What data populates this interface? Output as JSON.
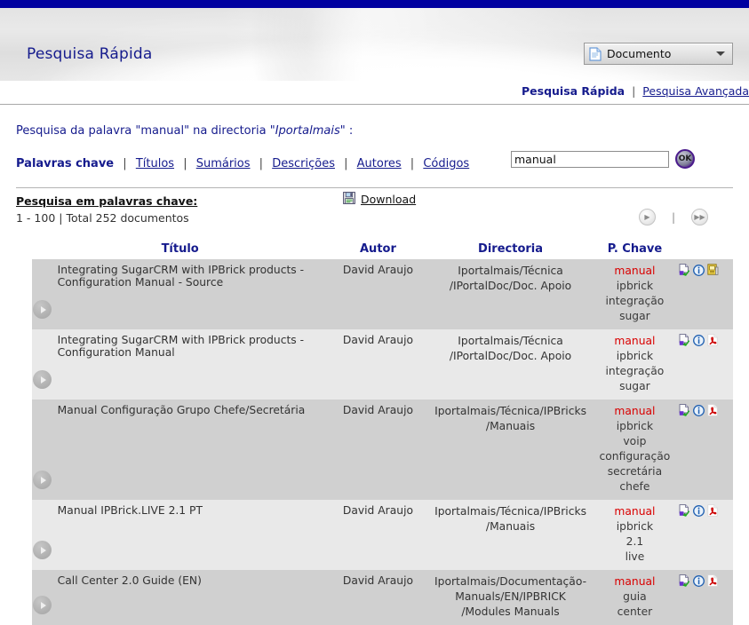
{
  "topbar": {
    "color": "#0000a0"
  },
  "banner": {
    "title": "Pesquisa Rápida",
    "doctype_label": "Documento",
    "doctype_icon": "document-icon",
    "dropdown_icon": "chevron-down-icon"
  },
  "nav": {
    "current": "Pesquisa Rápida",
    "separator": "|",
    "advanced": "Pesquisa Avançada"
  },
  "search_info": {
    "prefix": "Pesquisa da palavra \"manual\" na directoria \"",
    "directory": "Iportalmais",
    "suffix": "\" :"
  },
  "filters": {
    "active": "Palavras chave",
    "separator": "|",
    "items": [
      "Títulos",
      "Sumários",
      "Descrições",
      "Autores",
      "Códigos"
    ]
  },
  "search": {
    "value": "manual",
    "placeholder": "",
    "ok_label": "OK",
    "ok_icon": "ok-button-icon"
  },
  "results_header": {
    "title": "Pesquisa em palavras chave:",
    "range": "1 - 100",
    "range_sep": "|",
    "total": "Total 252 documentos",
    "download_label": "Download",
    "download_icon": "save-floppy-icon"
  },
  "pager": {
    "next_icon": "next-page-icon",
    "next_glyph": "▶",
    "separator": "|",
    "last_icon": "last-page-icon",
    "last_glyph": "▶▶"
  },
  "table": {
    "columns": [
      "Título",
      "Autor",
      "Directoria",
      "P. Chave"
    ],
    "rows": [
      {
        "title": "Integrating SugarCRM with IPBrick products - Configuration Manual - Source",
        "author": "David Araujo",
        "directory": "Iportalmais/Técnica\n/IPortalDoc/Doc. Apoio",
        "keywords": [
          "manual",
          "ipbrick",
          "integração",
          "sugar"
        ],
        "icons": [
          "edit-document-icon",
          "info-icon",
          "archive-file-icon"
        ],
        "expand_icon": "expand-row-icon"
      },
      {
        "title": "Integrating SugarCRM with IPBrick products - Configuration Manual",
        "author": "David Araujo",
        "directory": "Iportalmais/Técnica\n/IPortalDoc/Doc. Apoio",
        "keywords": [
          "manual",
          "ipbrick",
          "integração",
          "sugar"
        ],
        "icons": [
          "edit-document-icon",
          "info-icon",
          "pdf-file-icon"
        ],
        "expand_icon": "expand-row-icon"
      },
      {
        "title": "Manual Configuração Grupo Chefe/Secretária",
        "author": "David Araujo",
        "directory": "Iportalmais/Técnica/IPBricks\n/Manuais",
        "keywords": [
          "manual",
          "ipbrick",
          "voip",
          "configuração",
          "secretária",
          "chefe"
        ],
        "icons": [
          "edit-document-icon",
          "info-icon",
          "pdf-file-icon"
        ],
        "expand_icon": "expand-row-icon"
      },
      {
        "title": "Manual IPBrick.LIVE 2.1 PT",
        "author": "David Araujo",
        "directory": "Iportalmais/Técnica/IPBricks\n/Manuais",
        "keywords": [
          "manual",
          "ipbrick",
          "2.1",
          "live"
        ],
        "icons": [
          "edit-document-icon",
          "info-icon",
          "pdf-file-icon"
        ],
        "expand_icon": "expand-row-icon"
      },
      {
        "title": "Call Center 2.0 Guide (EN)",
        "author": "David Araujo",
        "directory": "Iportalmais/Documentação-\nManuals/EN/IPBRICK\n/Modules Manuals",
        "keywords": [
          "manual",
          "guia",
          "center"
        ],
        "icons": [
          "edit-document-icon",
          "info-icon",
          "pdf-file-icon"
        ],
        "expand_icon": "expand-row-icon"
      }
    ]
  },
  "colors": {
    "brand_blue": "#151b8d",
    "topbar_blue": "#0000a0",
    "keyword_highlight": "#d90000",
    "row_dark": "#d0d0d0",
    "row_light": "#e9e9e9"
  }
}
